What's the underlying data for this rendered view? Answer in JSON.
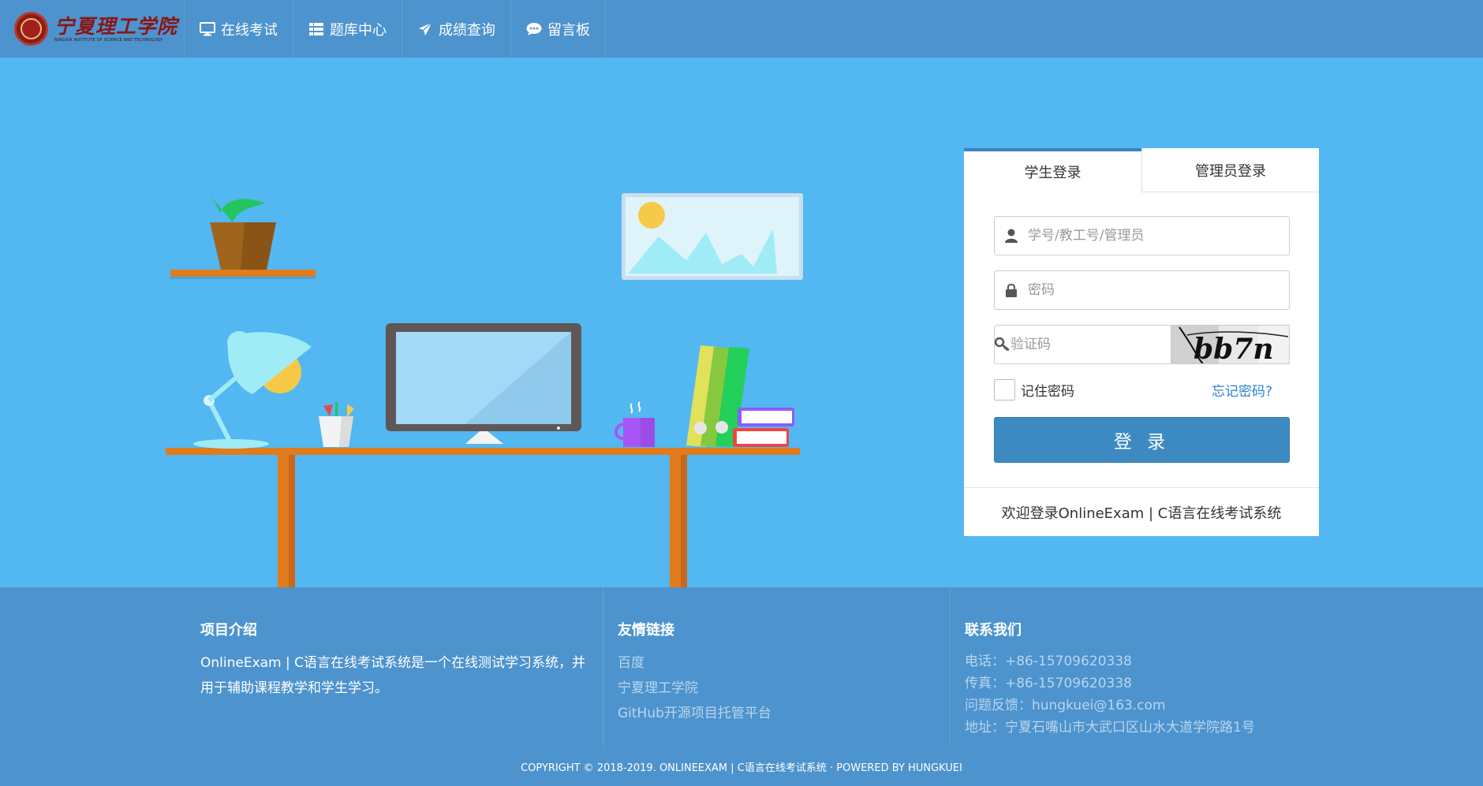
{
  "brand": {
    "name_cn": "宁夏理工学院",
    "name_en": "NINGXIA INSTITUTE OF SCIENCE AND TECHNOLOGY"
  },
  "nav": {
    "items": [
      {
        "label": "在线考试",
        "icon": "desktop-icon"
      },
      {
        "label": "题库中心",
        "icon": "table-list-icon"
      },
      {
        "label": "成绩查询",
        "icon": "paper-plane-icon"
      },
      {
        "label": "留言板",
        "icon": "comment-dots-icon"
      }
    ]
  },
  "login": {
    "tabs": [
      "学生登录",
      "管理员登录"
    ],
    "username_placeholder": "学号/教工号/管理员",
    "password_placeholder": "密码",
    "captcha_placeholder": "验证码",
    "captcha_text": "bb7n",
    "remember_label": "记住密码",
    "forgot_label": "忘记密码?",
    "submit_label": "登 录",
    "welcome": "欢迎登录OnlineExam | C语言在线考试系统"
  },
  "footer": {
    "about_title": "项目介绍",
    "about_text": "OnlineExam | C语言在线考试系统是一个在线测试学习系统，并用于辅助课程教学和学生学习。",
    "links_title": "友情链接",
    "links": [
      "百度",
      "宁夏理工学院",
      "GitHub开源项目托管平台"
    ],
    "contact_title": "联系我们",
    "contact": [
      "电话：+86-15709620338",
      "传真：+86-15709620338",
      "问题反馈：hungkuei@163.com",
      "地址：宁夏石嘴山市大武口区山水大道学院路1号"
    ],
    "copyright": "COPYRIGHT © 2018-2019. ONLINEEXAM | C语言在线考试系统 · POWERED BY HUNGKUEI"
  },
  "colors": {
    "navbar": "#4d93ce",
    "background": "#53b7f1",
    "button": "#3d8ac2",
    "link": "#2a83d1"
  }
}
